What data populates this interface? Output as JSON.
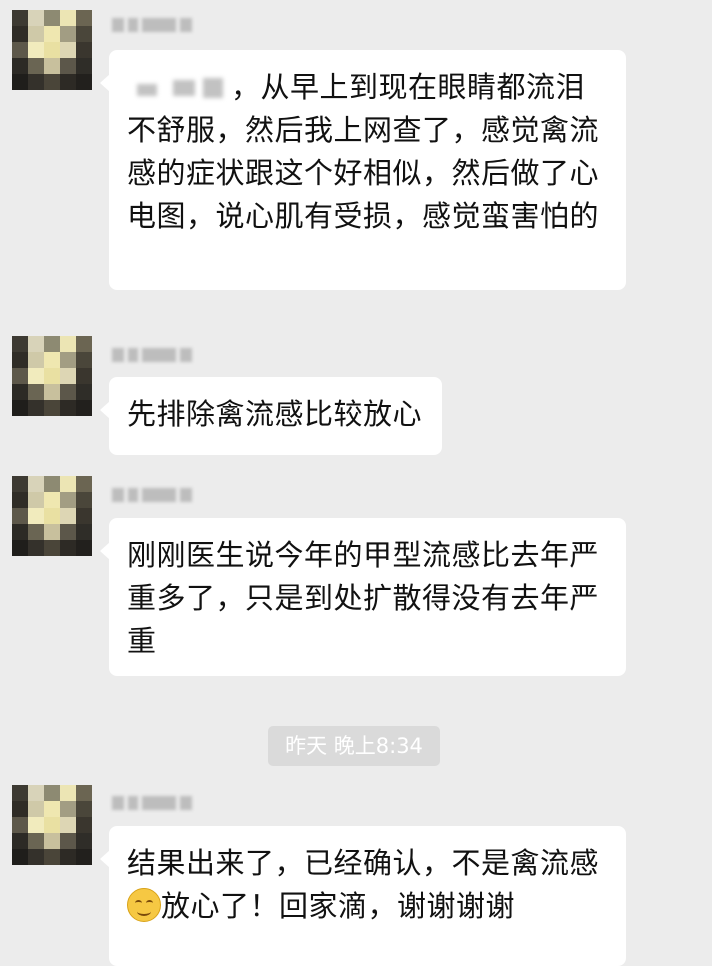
{
  "messages": [
    {
      "text_before": "",
      "text_after": "，从早上到现在眼睛都流泪不舒服，然后我上网查了，感觉禽流感的症状跟这个好相似，然后做了心电图，说心肌有受损，感觉蛮害怕的"
    },
    {
      "text": "先排除禽流感比较放心"
    },
    {
      "text": "刚刚医生说今年的甲型流感比去年严重多了，只是到处扩散得没有去年严重"
    },
    {
      "text_before": "结果出来了，已经确认，不是禽流感",
      "text_after": "放心了！回家滴，谢谢谢谢"
    }
  ],
  "time_divider": "昨天 晚上8:34",
  "icons": {
    "avatar": "pixelated-avatar-icon",
    "emoji": "smile-emoji-icon"
  },
  "colors": {
    "background": "#ececec",
    "bubble": "#ffffff",
    "text": "#111111",
    "time_divider_bg": "#dadada"
  }
}
